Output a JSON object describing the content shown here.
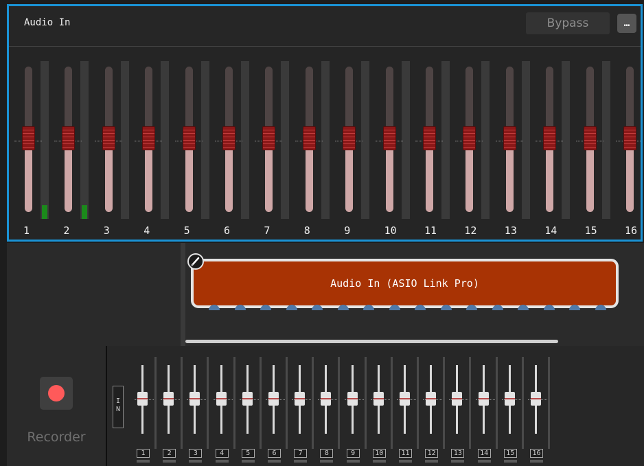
{
  "audio_panel": {
    "title": "Audio In",
    "bypass_label": "Bypass",
    "more_label": "…",
    "accent_color": "#1a93d6",
    "channels": [
      "1",
      "2",
      "3",
      "4",
      "5",
      "6",
      "7",
      "8",
      "9",
      "10",
      "11",
      "12",
      "13",
      "14",
      "15",
      "16"
    ],
    "active_meter_channels": [
      "1",
      "2"
    ]
  },
  "graph": {
    "node_label": "Audio In (ASIO Link Pro)",
    "node_color": "#a83304",
    "node_icon": "edit-icon"
  },
  "recorder": {
    "label": "Recorder",
    "record_icon": "record-icon",
    "in_label": "I N",
    "channels": [
      "1",
      "2",
      "3",
      "4",
      "5",
      "6",
      "7",
      "8",
      "9",
      "10",
      "11",
      "12",
      "13",
      "14",
      "15",
      "16"
    ]
  }
}
